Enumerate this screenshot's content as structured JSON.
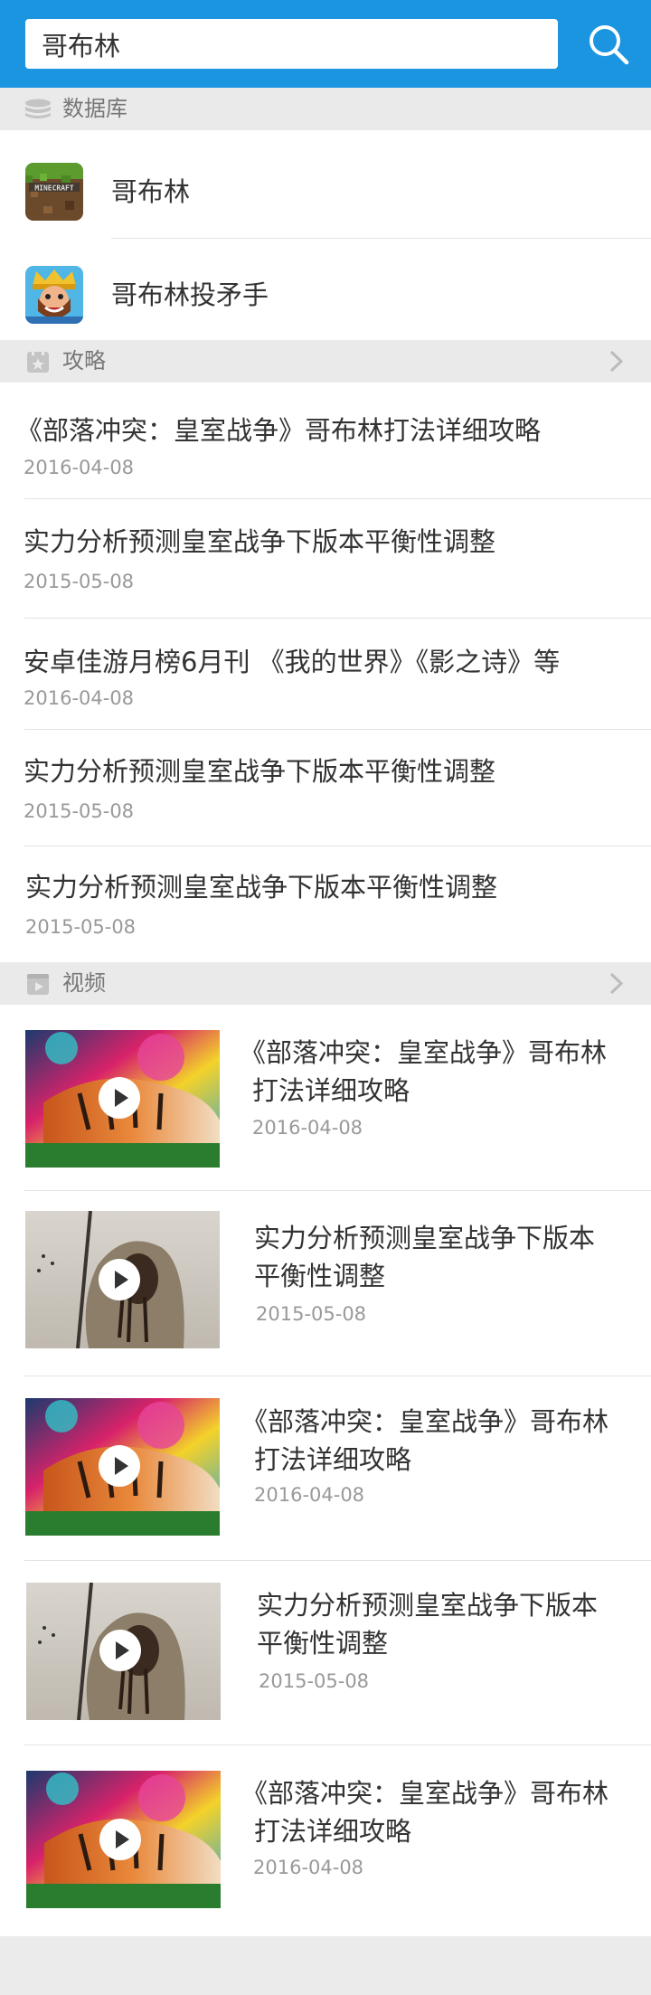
{
  "search": {
    "value": "哥布林"
  },
  "database": {
    "label": "数据库",
    "items": [
      {
        "name": "哥布林"
      },
      {
        "name": "哥布林投矛手"
      }
    ]
  },
  "strategy": {
    "label": "攻略",
    "articles": [
      {
        "title": "《部落冲突：皇室战争》哥布林打法详细攻略",
        "date": "2016-04-08"
      },
      {
        "title": "实力分析预测皇室战争下版本平衡性调整",
        "date": "2015-05-08"
      },
      {
        "title": "安卓佳游月榜6月刊 《我的世界》《影之诗》等",
        "date": "2016-04-08"
      },
      {
        "title": "实力分析预测皇室战争下版本平衡性调整",
        "date": "2015-05-08"
      },
      {
        "title": "实力分析预测皇室战争下版本平衡性调整",
        "date": "2015-05-08"
      }
    ]
  },
  "videos": {
    "label": "视频",
    "items": [
      {
        "line1": "《部落冲突：皇室战争》哥布林",
        "line2": "打法详细攻略",
        "date": "2016-04-08",
        "thumb": "tiger-thumbnail"
      },
      {
        "line1": "实力分析预测皇室战争下版本",
        "line2": "平衡性调整",
        "date": "2015-05-08",
        "thumb": "hooded-figure-thumbnail"
      },
      {
        "line1": "《部落冲突：皇室战争》哥布林",
        "line2": "打法详细攻略",
        "date": "2016-04-08",
        "thumb": "tiger-thumbnail"
      },
      {
        "line1": "实力分析预测皇室战争下版本",
        "line2": "平衡性调整",
        "date": "2015-05-08",
        "thumb": "hooded-figure-thumbnail"
      },
      {
        "line1": "《部落冲突：皇室战争》哥布林",
        "line2": "打法详细攻略",
        "date": "2016-04-08",
        "thumb": "tiger-thumbnail"
      }
    ]
  },
  "colors": {
    "header": "#1b95e0",
    "section_bg": "#eaeaea",
    "date": "#999999"
  }
}
